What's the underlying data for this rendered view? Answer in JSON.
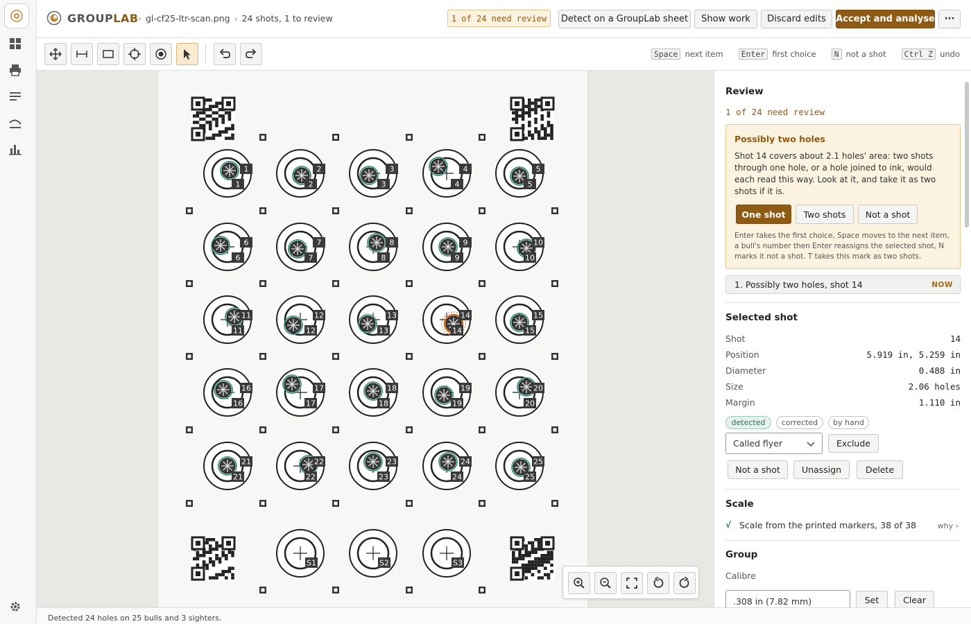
{
  "app": {
    "name_part1": "GROUP",
    "name_part2": "LAB"
  },
  "breadcrumb": {
    "file": "gl-cf25-ltr-scan.png",
    "summary": "24 shots, 1 to review"
  },
  "header": {
    "review_pill": "1 of 24 need review",
    "detect_button": "Detect on a GroupLab sheet",
    "show_work_button": "Show work",
    "discard_button": "Discard edits",
    "accept_button": "Accept and analyse",
    "more_button": "···"
  },
  "hints": [
    {
      "key": "Space",
      "label": "next item"
    },
    {
      "key": "Enter",
      "label": "first choice"
    },
    {
      "key": "N",
      "label": "not a shot"
    },
    {
      "key": "Ctrl Z",
      "label": "undo"
    }
  ],
  "sheet": {
    "bulls": [
      {
        "row": 0,
        "col": 0,
        "num": "1",
        "hole": [
          3,
          -4
        ],
        "tag_pos": "ur"
      },
      {
        "row": 0,
        "col": 1,
        "num": "2",
        "hole": [
          2,
          3
        ],
        "tag_pos": "ur"
      },
      {
        "row": 0,
        "col": 2,
        "num": "3",
        "hole": [
          -6,
          3
        ],
        "tag_pos": "ur"
      },
      {
        "row": 0,
        "col": 3,
        "num": "4",
        "hole": [
          -12,
          -10
        ],
        "tag_pos": "ur"
      },
      {
        "row": 0,
        "col": 4,
        "num": "5",
        "hole": [
          0,
          4
        ],
        "tag_pos": "ur"
      },
      {
        "row": 1,
        "col": 0,
        "num": "6",
        "hole": [
          -10,
          -2
        ],
        "tag_pos": "ur"
      },
      {
        "row": 1,
        "col": 1,
        "num": "7",
        "hole": [
          -4,
          3
        ],
        "tag_pos": "ur"
      },
      {
        "row": 1,
        "col": 2,
        "num": "8",
        "hole": [
          5,
          -6
        ],
        "tag_pos": "ur"
      },
      {
        "row": 1,
        "col": 3,
        "num": "9",
        "hole": [
          2,
          0
        ],
        "tag_pos": "ur"
      },
      {
        "row": 1,
        "col": 4,
        "num": "10",
        "hole": [
          10,
          2
        ],
        "tag_pos": "ur"
      },
      {
        "row": 2,
        "col": 0,
        "num": "11",
        "hole": [
          10,
          -4
        ],
        "tag_pos": "ur"
      },
      {
        "row": 2,
        "col": 1,
        "num": "12",
        "hole": [
          -10,
          8
        ],
        "tag_pos": "ur"
      },
      {
        "row": 2,
        "col": 2,
        "num": "13",
        "hole": [
          -8,
          6
        ],
        "tag_pos": "ur"
      },
      {
        "row": 2,
        "col": 3,
        "num": "14",
        "hole": [
          10,
          6
        ],
        "tag_pos": "ur"
      },
      {
        "row": 2,
        "col": 4,
        "num": "15",
        "hole": [
          0,
          4
        ],
        "tag_pos": "ur"
      },
      {
        "row": 3,
        "col": 0,
        "num": "16",
        "hole": [
          -6,
          -4
        ],
        "tag_pos": "ur"
      },
      {
        "row": 3,
        "col": 1,
        "num": "17",
        "hole": [
          -12,
          -12
        ],
        "tag_pos": "ur"
      },
      {
        "row": 3,
        "col": 2,
        "num": "18",
        "hole": [
          0,
          -2
        ],
        "tag_pos": "ur"
      },
      {
        "row": 3,
        "col": 3,
        "num": "19",
        "hole": [
          -4,
          4
        ],
        "tag_pos": "ur"
      },
      {
        "row": 3,
        "col": 4,
        "num": "20",
        "hole": [
          10,
          -8
        ],
        "tag_pos": "ur"
      },
      {
        "row": 4,
        "col": 0,
        "num": "21",
        "hole": [
          0,
          0
        ],
        "tag_pos": "ur"
      },
      {
        "row": 4,
        "col": 1,
        "num": "22",
        "hole": [
          12,
          -2
        ],
        "tag_pos": "ur"
      },
      {
        "row": 4,
        "col": 2,
        "num": "23",
        "hole": [
          0,
          -6
        ],
        "tag_pos": "ur"
      },
      {
        "row": 4,
        "col": 3,
        "num": "24",
        "hole": [
          2,
          -6
        ],
        "tag_pos": "ur"
      },
      {
        "row": 4,
        "col": 4,
        "num": "25",
        "hole": [
          2,
          2
        ],
        "tag_pos": "ur"
      }
    ],
    "sighters": [
      "S1",
      "S2",
      "S3"
    ],
    "selected_shot": "14"
  },
  "panel": {
    "review_title": "Review",
    "review_count": "1 of 24 need review",
    "issue_title": "Possibly two holes",
    "issue_text": "Shot 14 covers about 2.1 holes' area: two shots through one hole, or a hole joined to ink, would each read this way. Look at it, and take it as two shots if it is.",
    "choice_one": "One shot",
    "choice_two": "Two shots",
    "choice_not": "Not a shot",
    "issue_help": "Enter takes the first choice, Space moves to the next item, a bull's number then Enter reassigns the selected shot, N marks it not a shot. T takes this mark as two shots.",
    "queue_item": "1.  Possibly two holes, shot 14",
    "queue_now": "NOW",
    "selected_title": "Selected shot",
    "fields": [
      {
        "k": "Shot",
        "v": "14"
      },
      {
        "k": "Position",
        "v": "5.919 in, 5.259 in"
      },
      {
        "k": "Diameter",
        "v": "0.488 in"
      },
      {
        "k": "Size",
        "v": "2.06 holes"
      },
      {
        "k": "Margin",
        "v": "1.110 in"
      }
    ],
    "tag_detected": "detected",
    "tag_corrected": "corrected",
    "tag_byhand": "by hand",
    "called_select": "Called flyer",
    "exclude_button": "Exclude",
    "not_shot_button": "Not a shot",
    "unassign_button": "Unassign",
    "delete_button": "Delete",
    "scale_title": "Scale",
    "scale_text": "Scale from the printed markers, 38 of 38",
    "scale_check": "√",
    "scale_why": "why ›",
    "group_title": "Group",
    "calibre_label": "Calibre",
    "calibre_value": ".308 in (7.82 mm)",
    "set_button": "Set",
    "clear_button": "Clear"
  },
  "status": "Detected 24 holes on 25 bulls and 3 sighters.",
  "colors": {
    "accent": "#8e5a14",
    "review_bg": "#fbf2df",
    "teal": "#3f8f7e",
    "selected": "#c8702a"
  }
}
